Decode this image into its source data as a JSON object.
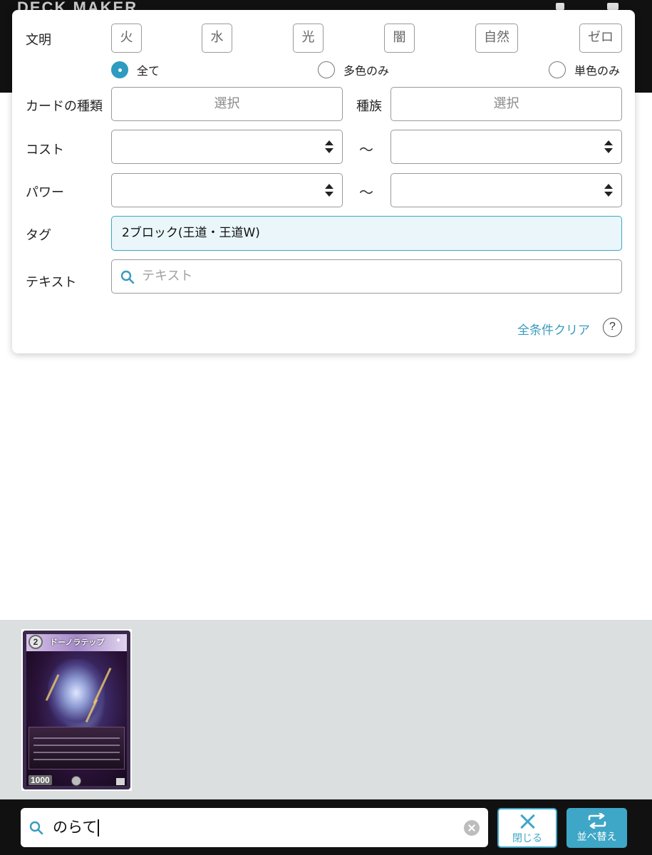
{
  "header": {
    "logo_text": "DECK MAKER"
  },
  "filter": {
    "civilization": {
      "label": "文明",
      "buttons": [
        "火",
        "水",
        "光",
        "闇",
        "自然",
        "ゼロ"
      ]
    },
    "color_mode": {
      "options": [
        "全て",
        "多色のみ",
        "単色のみ"
      ],
      "selected": "全て"
    },
    "card_type": {
      "label": "カードの種類",
      "value": "選択"
    },
    "race": {
      "label": "種族",
      "value": "選択"
    },
    "cost": {
      "label": "コスト",
      "min": "",
      "max": "",
      "range_sep": "〜"
    },
    "power": {
      "label": "パワー",
      "min": "",
      "max": "",
      "range_sep": "〜"
    },
    "tag": {
      "label": "タグ",
      "value": "2ブロック(王道・王道W)"
    },
    "text": {
      "label": "テキスト",
      "placeholder": "テキスト"
    },
    "clear_all": "全条件クリア",
    "help": "?"
  },
  "results": {
    "cards": [
      {
        "name": "ドーノラテップ",
        "cost": "2",
        "power": "1000"
      }
    ]
  },
  "bottom": {
    "search_value": "のらて",
    "close_label": "閉じる",
    "sort_label": "並べ替え"
  },
  "colors": {
    "accent": "#3ea6c6",
    "tag_bg": "#eaf6f9",
    "dark_bar": "#111111",
    "results_bg": "#dcdfe0"
  }
}
